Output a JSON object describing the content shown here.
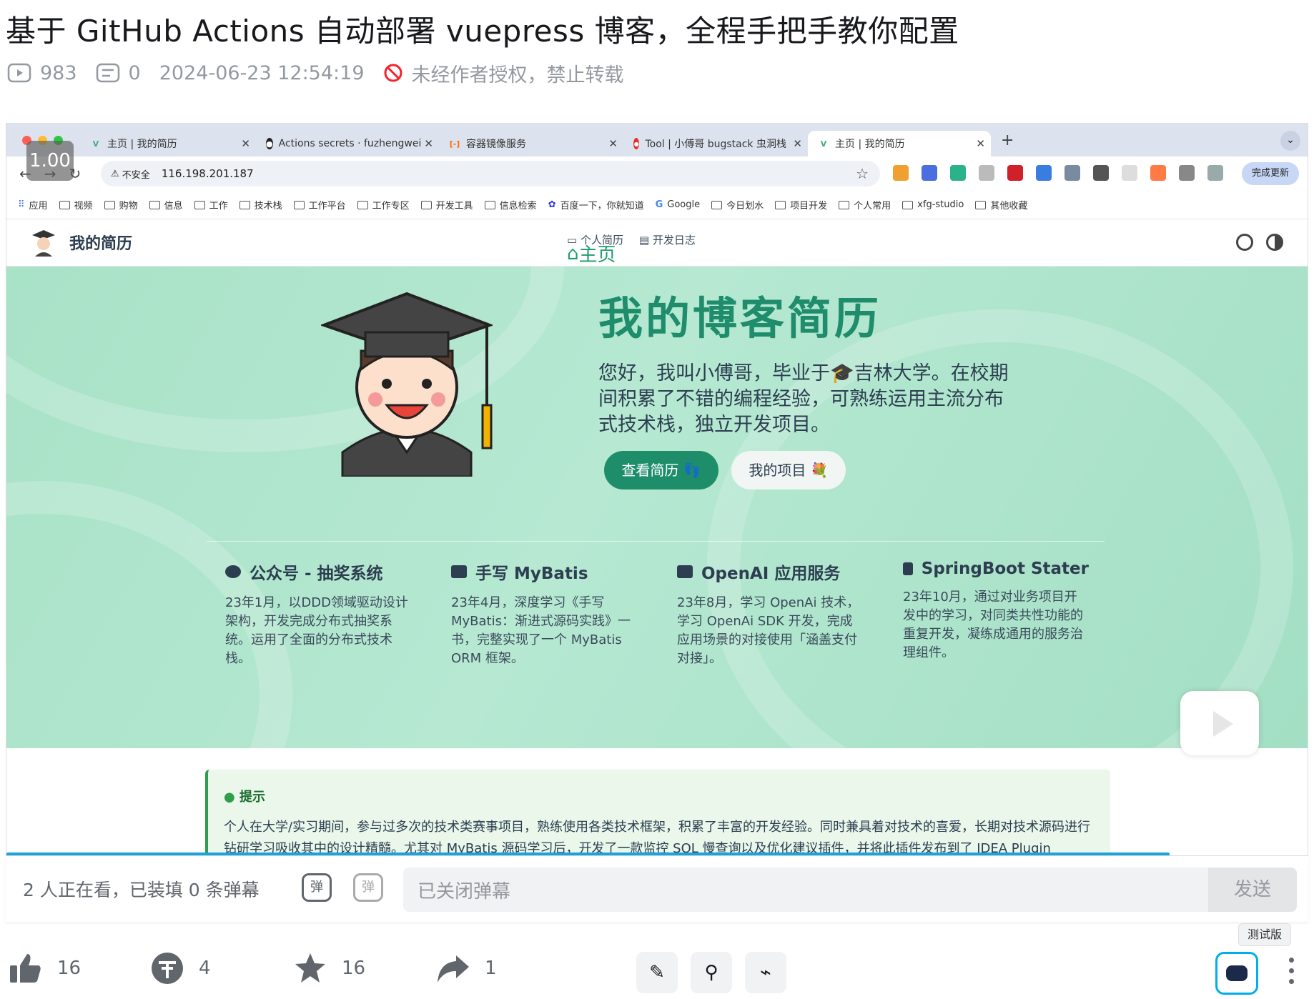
{
  "video": {
    "title": "基于 GitHub Actions 自动部署 vuepress 博客，全程手把手教你配置",
    "views": "983",
    "danmaku_count": "0",
    "publish_time": "2024-06-23 12:54:19",
    "copyright": "未经作者授权，禁止转载",
    "speed": "1.00",
    "progress": 0.894
  },
  "browser": {
    "tabs": [
      {
        "label": "主页 | 我的简历",
        "favicon": "vuepress-icon",
        "active": false
      },
      {
        "label": "Actions secrets · fuzhengwei",
        "favicon": "github-icon",
        "active": false
      },
      {
        "label": "容器镜像服务",
        "favicon": "aliyun-icon",
        "active": false
      },
      {
        "label": "Tool | 小傅哥 bugstack 虫洞栈",
        "favicon": "bugstack-icon",
        "active": false
      },
      {
        "label": "主页 | 我的简历",
        "favicon": "vuepress-icon",
        "active": true
      }
    ],
    "security": "不安全",
    "url": "116.198.201.187",
    "profile": "完成更新",
    "bookmarks": [
      "应用",
      "视频",
      "购物",
      "信息",
      "工作",
      "技术栈",
      "工作平台",
      "工作专区",
      "开发工具",
      "信息检索",
      "百度一下，你就知道",
      "Google",
      "今日划水",
      "项目开发",
      "个人常用",
      "xfg-studio",
      "其他收藏"
    ]
  },
  "site": {
    "brand": "我的简历",
    "nav": [
      {
        "label": "主页",
        "active": true
      },
      {
        "label": "个人简历",
        "active": false
      },
      {
        "label": "开发日志",
        "active": false
      }
    ],
    "hero_title": "我的博客简历",
    "hero_desc": "您好，我叫小傅哥，毕业于🎓吉林大学。在校期间积累了不错的编程经验，可熟练运用主流分布式技术栈，独立开发项目。",
    "btn_resume": "查看简历 👣",
    "btn_projects": "我的项目 💐",
    "features": [
      {
        "title": "公众号 - 抽奖系统",
        "desc": "23年1月，以DDD领域驱动设计架构，开发完成分布式抽奖系统。运用了全面的分布式技术栈。"
      },
      {
        "title": "手写 MyBatis",
        "desc": "23年4月，深度学习《手写 MyBatis：渐进式源码实践》一书，完整实现了一个 MyBatis ORM 框架。"
      },
      {
        "title": "OpenAI 应用服务",
        "desc": "23年8月，学习 OpenAi 技术，学习 OpenAi SDK 开发，完成应用场景的对接使用「涵盖支付对接」。"
      },
      {
        "title": "SpringBoot Stater",
        "desc": "23年10月，通过对业务项目开发中的学习，对同类共性功能的重复开发，凝练成通用的服务治理组件。"
      }
    ],
    "tip_title": "提示",
    "tip_text": "个人在大学/实习期间，参与过多次的技术类赛事项目，熟练使用各类技术框架，积累了丰富的开发经验。同时兼具着对技术的喜爱，长期对技术源码进行钻研学习吸收其中的设计精髓。尤其对 MyBatis 源码学习后，开发了一款监控 SQL 慢查询以及优化建议插件，并将此插件发布到了 IDEA Plugin"
  },
  "danmaku": {
    "status": "2 人正在看，已装填 0 条弹幕",
    "toggle_icon": "弹",
    "settings_icon": "弹",
    "placeholder": "已关闭弹幕",
    "send": "发送"
  },
  "actions": {
    "like": "16",
    "coin": "4",
    "favorite": "16",
    "share": "1",
    "beta": "测试版"
  },
  "colors": {
    "accent": "#1f8c6c",
    "button": "#1e8e6a",
    "progress": "#1aa3dc",
    "bili_blue": "#00aeec"
  }
}
